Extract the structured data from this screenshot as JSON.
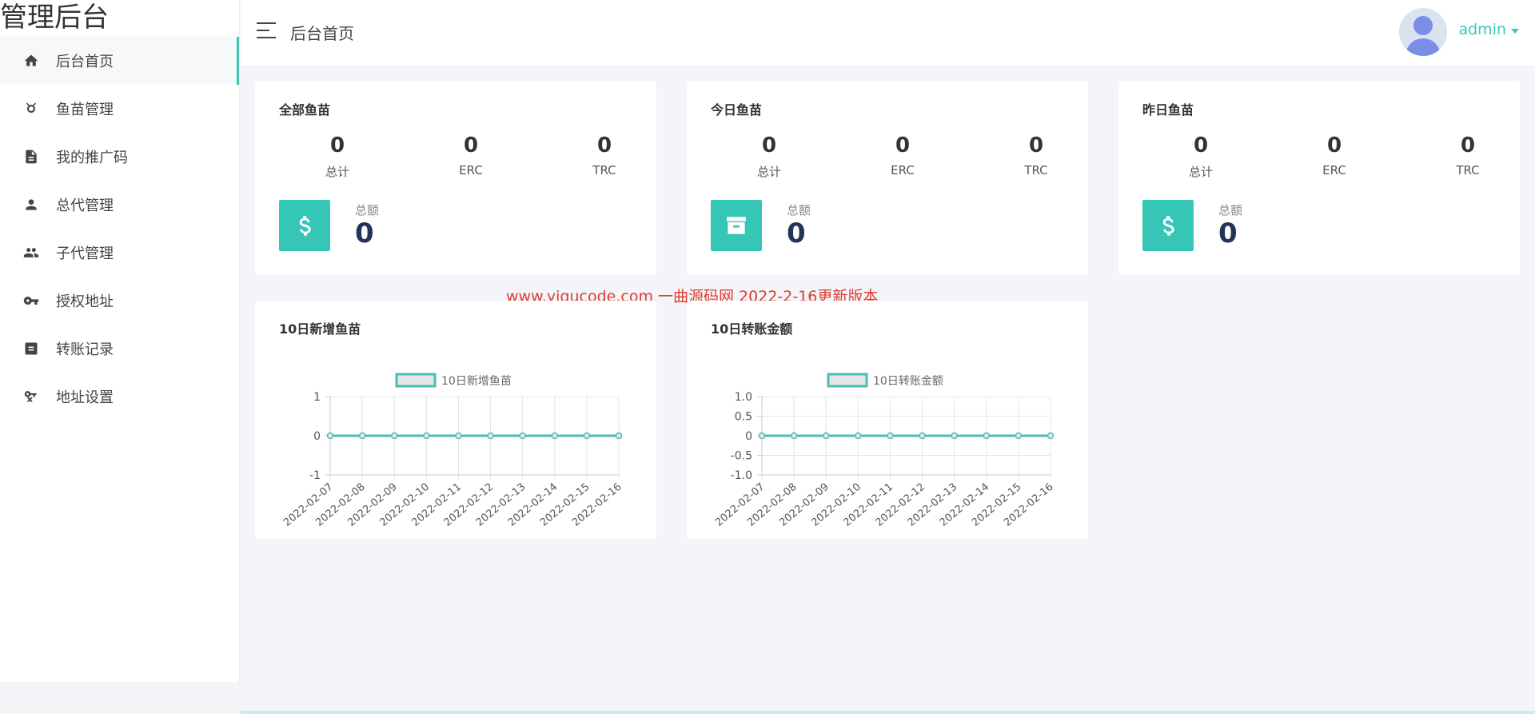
{
  "brand": "管理后台",
  "header": {
    "title": "后台首页",
    "user": "admin"
  },
  "sidebar": {
    "items": [
      {
        "label": "后台首页",
        "icon": "home-icon",
        "active": true
      },
      {
        "label": "鱼苗管理",
        "icon": "fish-icon"
      },
      {
        "label": "我的推广码",
        "icon": "document-icon"
      },
      {
        "label": "总代管理",
        "icon": "person-icon"
      },
      {
        "label": "子代管理",
        "icon": "people-icon"
      },
      {
        "label": "授权地址",
        "icon": "key-icon"
      },
      {
        "label": "转账记录",
        "icon": "list-box-icon"
      },
      {
        "label": "地址设置",
        "icon": "key-setting-icon"
      }
    ]
  },
  "cards": [
    {
      "title": "全部鱼苗",
      "stats": [
        {
          "value": "0",
          "label": "总计"
        },
        {
          "value": "0",
          "label": "ERC"
        },
        {
          "value": "0",
          "label": "TRC"
        }
      ],
      "total_label": "总额",
      "total_value": "0",
      "icon": "dollar-icon"
    },
    {
      "title": "今日鱼苗",
      "stats": [
        {
          "value": "0",
          "label": "总计"
        },
        {
          "value": "0",
          "label": "ERC"
        },
        {
          "value": "0",
          "label": "TRC"
        }
      ],
      "total_label": "总额",
      "total_value": "0",
      "icon": "archive-icon"
    },
    {
      "title": "昨日鱼苗",
      "stats": [
        {
          "value": "0",
          "label": "总计"
        },
        {
          "value": "0",
          "label": "ERC"
        },
        {
          "value": "0",
          "label": "TRC"
        }
      ],
      "total_label": "总额",
      "total_value": "0",
      "icon": "dollar-icon"
    }
  ],
  "watermark": "www.yiqucode.com 一曲源码网 2022-2-16更新版本",
  "colors": {
    "accent": "#35c6b6",
    "line": "#4bbdb5",
    "watermark": "#e03a2f"
  },
  "chart_data": [
    {
      "type": "line",
      "title": "10日新增鱼苗",
      "x": [
        "2022-02-07",
        "2022-02-08",
        "2022-02-09",
        "2022-02-10",
        "2022-02-11",
        "2022-02-12",
        "2022-02-13",
        "2022-02-14",
        "2022-02-15",
        "2022-02-16"
      ],
      "series": [
        {
          "name": "10日新增鱼苗",
          "values": [
            0,
            0,
            0,
            0,
            0,
            0,
            0,
            0,
            0,
            0
          ]
        }
      ],
      "ylim": [
        -1,
        1
      ],
      "yticks": [
        "1",
        "0",
        "-1"
      ],
      "grid": true,
      "legend": "top"
    },
    {
      "type": "line",
      "title": "10日转账金额",
      "x": [
        "2022-02-07",
        "2022-02-08",
        "2022-02-09",
        "2022-02-10",
        "2022-02-11",
        "2022-02-12",
        "2022-02-13",
        "2022-02-14",
        "2022-02-15",
        "2022-02-16"
      ],
      "series": [
        {
          "name": "10日转账金额",
          "values": [
            0,
            0,
            0,
            0,
            0,
            0,
            0,
            0,
            0,
            0
          ]
        }
      ],
      "ylim": [
        -1,
        1
      ],
      "yticks": [
        "1.0",
        "0.5",
        "0",
        "-0.5",
        "-1.0"
      ],
      "grid": true,
      "legend": "top"
    }
  ]
}
